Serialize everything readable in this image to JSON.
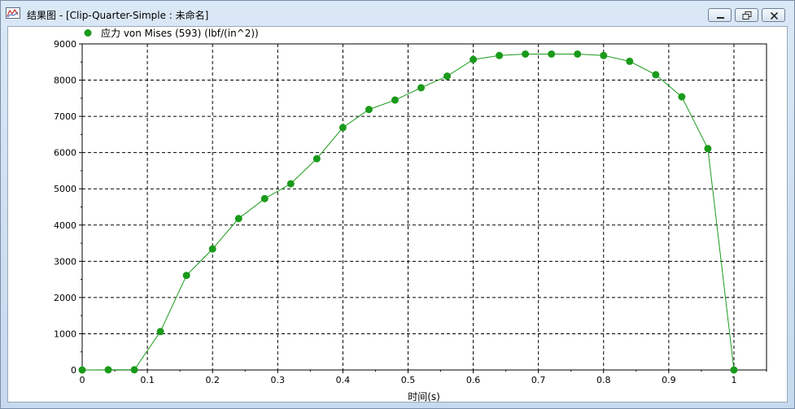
{
  "window": {
    "title": "结果图 - [Clip-Quarter-Simple : 未命名]",
    "icons": {
      "app": "chart-icon",
      "minimize": "minimize-icon",
      "maximize": "restore-icon",
      "close": "close-icon"
    }
  },
  "chart_data": {
    "type": "line",
    "xlabel": "时间(s)",
    "ylabel": "",
    "xlim": [
      0,
      1.05
    ],
    "ylim": [
      0,
      9000
    ],
    "xticks": [
      0,
      0.1,
      0.2,
      0.3,
      0.4,
      0.5,
      0.6,
      0.7,
      0.8,
      0.9,
      1
    ],
    "xtick_labels": [
      "0",
      "0.1",
      "0.2",
      "0.3",
      "0.4",
      "0.5",
      "0.6",
      "0.7",
      "0.8",
      "0.9",
      "1"
    ],
    "yticks": [
      0,
      1000,
      2000,
      3000,
      4000,
      5000,
      6000,
      7000,
      8000,
      9000
    ],
    "ytick_labels": [
      "0",
      "1000",
      "2000",
      "3000",
      "4000",
      "5000",
      "6000",
      "7000",
      "8000",
      "9000"
    ],
    "grid": true,
    "legend": "top-left",
    "series": [
      {
        "name": "应力 von Mises (593) (lbf/(in^2))",
        "color": "#1a9a1a",
        "x": [
          0,
          0.04,
          0.08,
          0.12,
          0.16,
          0.2,
          0.24,
          0.28,
          0.32,
          0.36,
          0.4,
          0.44,
          0.48,
          0.52,
          0.56,
          0.6,
          0.64,
          0.68,
          0.72,
          0.76,
          0.8,
          0.84,
          0.88,
          0.92,
          0.96,
          1.0
        ],
        "y": [
          0,
          5,
          5,
          1060,
          2610,
          3340,
          4180,
          4730,
          5140,
          5830,
          6690,
          7190,
          7450,
          7790,
          8110,
          8570,
          8680,
          8720,
          8720,
          8720,
          8680,
          8520,
          8150,
          7540,
          6110,
          0
        ]
      }
    ]
  }
}
